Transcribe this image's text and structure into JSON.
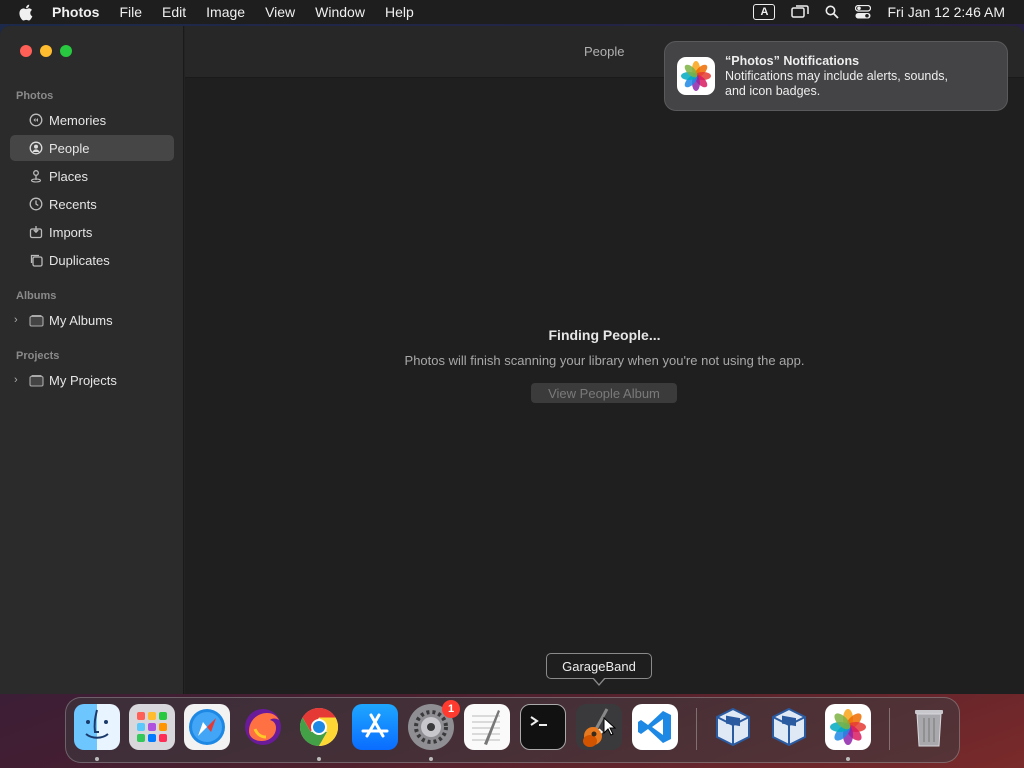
{
  "menubar": {
    "app_name": "Photos",
    "items": [
      "File",
      "Edit",
      "Image",
      "View",
      "Window",
      "Help"
    ],
    "input_badge": "A",
    "clock": "Fri Jan 12  2:46 AM"
  },
  "window": {
    "toolbar_title": "People"
  },
  "sidebar": {
    "sections": {
      "photos": "Photos",
      "albums": "Albums",
      "projects": "Projects"
    },
    "items": [
      {
        "label": "Memories",
        "icon": "memories-icon"
      },
      {
        "label": "People",
        "icon": "person-icon",
        "selected": true
      },
      {
        "label": "Places",
        "icon": "pin-icon"
      },
      {
        "label": "Recents",
        "icon": "clock-icon"
      },
      {
        "label": "Imports",
        "icon": "import-icon"
      },
      {
        "label": "Duplicates",
        "icon": "duplicate-icon"
      }
    ],
    "albums": [
      {
        "label": "My Albums",
        "icon": "folder-icon"
      }
    ],
    "projects": [
      {
        "label": "My Projects",
        "icon": "folder-icon"
      }
    ]
  },
  "main": {
    "title": "Finding People...",
    "description": "Photos will finish scanning your library when you're not using the app.",
    "button": "View People Album"
  },
  "notification": {
    "title": "“Photos” Notifications",
    "body_line1": "Notifications may include alerts, sounds,",
    "body_line2": "and icon badges."
  },
  "tooltip": "GarageBand",
  "dock": {
    "apps": [
      "Finder",
      "Launchpad",
      "Safari",
      "Firefox",
      "Chrome",
      "App Store",
      "System Preferences",
      "TextEdit",
      "Terminal",
      "GarageBand",
      "Visual Studio Code",
      "VirtualBox",
      "VirtualBox",
      "Photos",
      "Trash"
    ],
    "settings_badge": "1"
  }
}
